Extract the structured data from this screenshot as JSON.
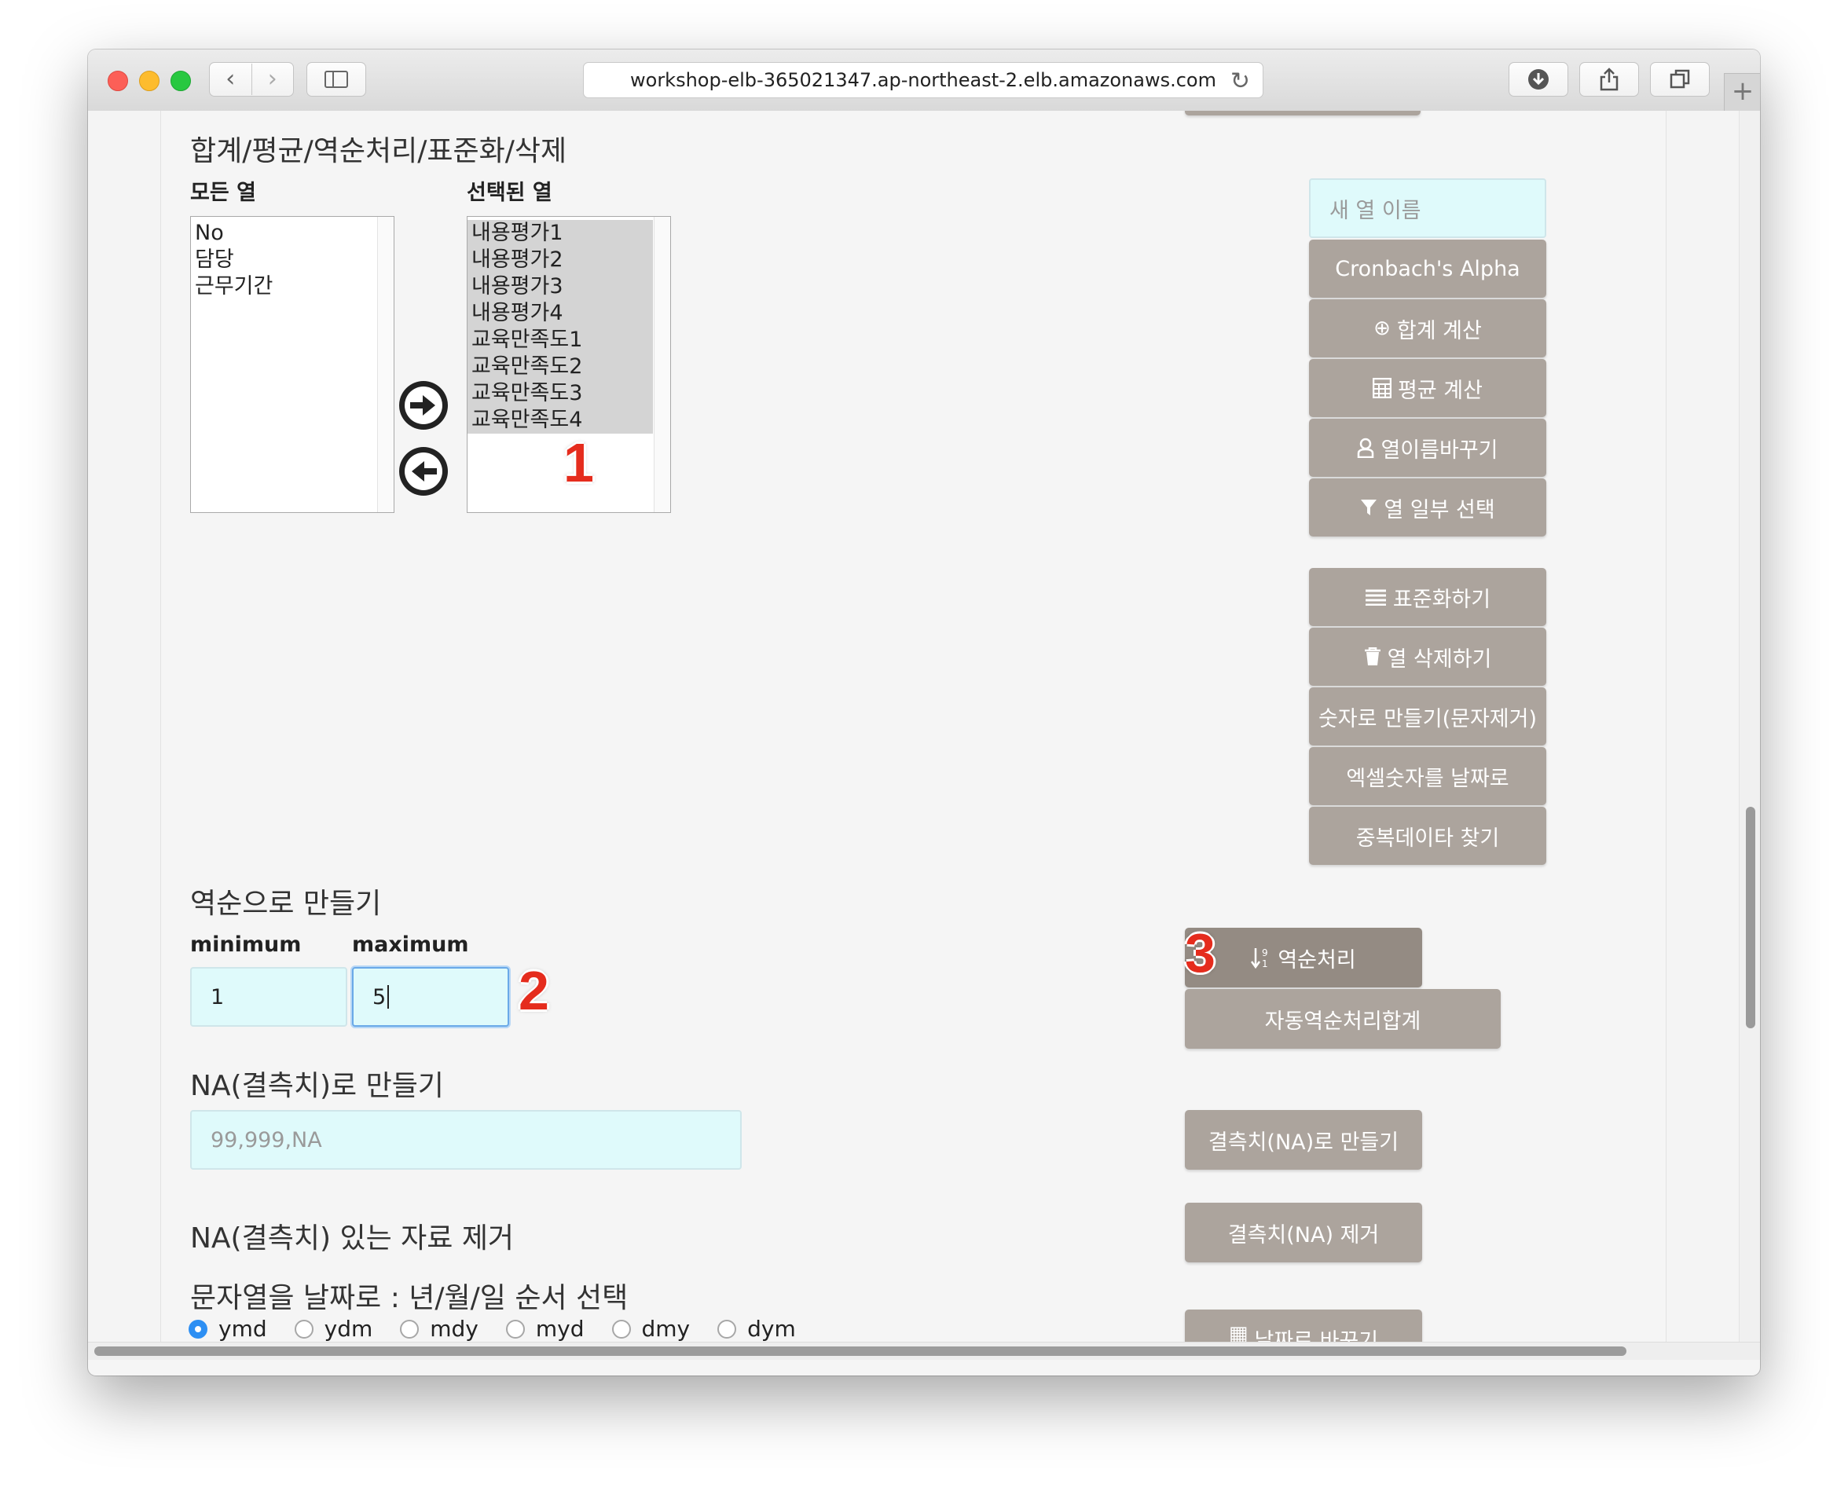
{
  "browser": {
    "url": "workshop-elb-365021347.ap-northeast-2.elb.amazonaws.com"
  },
  "section": {
    "title": "합계/평균/역순처리/표준화/삭제",
    "all_columns_label": "모든 열",
    "selected_columns_label": "선택된 열",
    "all_columns": [
      "No",
      "담당",
      "근무기간"
    ],
    "selected_columns": [
      "내용평가1",
      "내용평가2",
      "내용평가3",
      "내용평가4",
      "교육만족도1",
      "교육만족도2",
      "교육만족도3",
      "교육만족도4"
    ],
    "new_column_placeholder": "새 열 이름"
  },
  "buttons_group1": [
    {
      "label": "Cronbach's Alpha",
      "icon": ""
    },
    {
      "label": "합계 계산",
      "icon": "plus-circle-icon"
    },
    {
      "label": "평균 계산",
      "icon": "calculator-icon"
    },
    {
      "label": "열이름바꾸기",
      "icon": "user-icon"
    },
    {
      "label": "열 일부 선택",
      "icon": "filter-icon"
    }
  ],
  "buttons_group2": [
    {
      "label": "표준화하기",
      "icon": "list-icon"
    },
    {
      "label": "열 삭제하기",
      "icon": "trash-icon"
    },
    {
      "label": "숫자로 만들기(문자제거)",
      "icon": ""
    },
    {
      "label": "엑셀숫자를 날짜로",
      "icon": ""
    },
    {
      "label": "중복데이타 찾기",
      "icon": ""
    }
  ],
  "reverse": {
    "title": "역순으로 만들기",
    "min_label": "minimum",
    "max_label": "maximum",
    "min_value": "1",
    "max_value": "5",
    "button": "역순처리",
    "auto_button": "자동역순처리합계"
  },
  "na": {
    "title": "NA(결측치)로 만들기",
    "placeholder": "99,999,NA",
    "button": "결측치(NA)로 만들기",
    "remove_title": "NA(결측치) 있는 자료 제거",
    "remove_button": "결측치(NA) 제거"
  },
  "date": {
    "title": "문자열을 날짜로 : 년/월/일 순서 선택",
    "options": [
      "ymd",
      "ydm",
      "mdy",
      "myd",
      "dmy",
      "dym"
    ],
    "selected": "ymd",
    "button": "날짜로 바꾸기"
  },
  "annotations": [
    "1",
    "2",
    "3"
  ],
  "colors": {
    "button_bg": "#aca49d",
    "input_bg": "#dffafb",
    "annotation": "#e52c1d",
    "radio_selected": "#2d8ff3"
  }
}
